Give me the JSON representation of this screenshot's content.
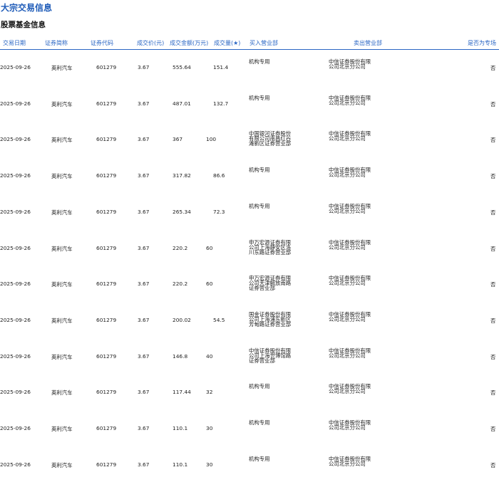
{
  "page_title": "大宗交易信息",
  "section_title": "股票基金信息",
  "columns": [
    "交易日期",
    "证券简称",
    "证券代码",
    "成交价(元)",
    "成交金额(万元)",
    "成交量(★)",
    "买入营业部",
    "卖出营业部",
    "是否为专场"
  ],
  "rows": [
    {
      "date": "2025-09-26",
      "name": "英利汽车",
      "code": "601279",
      "price": "3.67",
      "amount": "555.64",
      "volume": "151.4",
      "buyer": "机构专用",
      "seller": "中信证券股份有限公司北京分公司",
      "special": "否"
    },
    {
      "date": "2025-09-26",
      "name": "英利汽车",
      "code": "601279",
      "price": "3.67",
      "amount": "487.01",
      "volume": "132.7",
      "buyer": "机构专用",
      "seller": "中信证券股份有限公司北京分公司",
      "special": "否"
    },
    {
      "date": "2025-09-26",
      "name": "英利汽车",
      "code": "601279",
      "price": "3.67",
      "amount": "367",
      "volume": "100",
      "buyer": "中国银河证券股份有限公司南昌红谷滩新区证券营业部",
      "seller": "中信证券股份有限公司北京分公司",
      "special": "否"
    },
    {
      "date": "2025-09-26",
      "name": "英利汽车",
      "code": "601279",
      "price": "3.67",
      "amount": "317.82",
      "volume": "86.6",
      "buyer": "机构专用",
      "seller": "中信证券股份有限公司北京分公司",
      "special": "否"
    },
    {
      "date": "2025-09-26",
      "name": "英利汽车",
      "code": "601279",
      "price": "3.67",
      "amount": "265.34",
      "volume": "72.3",
      "buyer": "机构专用",
      "seller": "中信证券股份有限公司北京分公司",
      "special": "否"
    },
    {
      "date": "2025-09-26",
      "name": "英利汽车",
      "code": "601279",
      "price": "3.67",
      "amount": "220.2",
      "volume": "60",
      "buyer": "申万宏源证券有限公司上海静安区洛川东路证券营业部",
      "seller": "中信证券股份有限公司北京分公司",
      "special": "否"
    },
    {
      "date": "2025-09-26",
      "name": "英利汽车",
      "code": "601279",
      "price": "3.67",
      "amount": "220.2",
      "volume": "60",
      "buyer": "申万宏源证券有限公司天津解放南路证券营业部",
      "seller": "中信证券股份有限公司北京分公司",
      "special": "否"
    },
    {
      "date": "2025-09-26",
      "name": "英利汽车",
      "code": "601279",
      "price": "3.67",
      "amount": "200.02",
      "volume": "54.5",
      "buyer": "国金证券股份有限公司上海浦东新区芳甸路证券营业部",
      "seller": "中信证券股份有限公司北京分公司",
      "special": "否"
    },
    {
      "date": "2025-09-26",
      "name": "英利汽车",
      "code": "601279",
      "price": "3.67",
      "amount": "146.8",
      "volume": "40",
      "buyer": "中信证券股份有限公司上海世博馆路证券营业部",
      "seller": "中信证券股份有限公司北京分公司",
      "special": "否"
    },
    {
      "date": "2025-09-26",
      "name": "英利汽车",
      "code": "601279",
      "price": "3.67",
      "amount": "117.44",
      "volume": "32",
      "buyer": "机构专用",
      "seller": "中信证券股份有限公司北京分公司",
      "special": "否"
    },
    {
      "date": "2025-09-26",
      "name": "英利汽车",
      "code": "601279",
      "price": "3.67",
      "amount": "110.1",
      "volume": "30",
      "buyer": "机构专用",
      "seller": "中信证券股份有限公司北京分公司",
      "special": "否"
    },
    {
      "date": "2025-09-26",
      "name": "英利汽车",
      "code": "601279",
      "price": "3.67",
      "amount": "110.1",
      "volume": "30",
      "buyer": "机构专用",
      "seller": "中信证券股份有限公司北京分公司",
      "special": "否"
    }
  ]
}
